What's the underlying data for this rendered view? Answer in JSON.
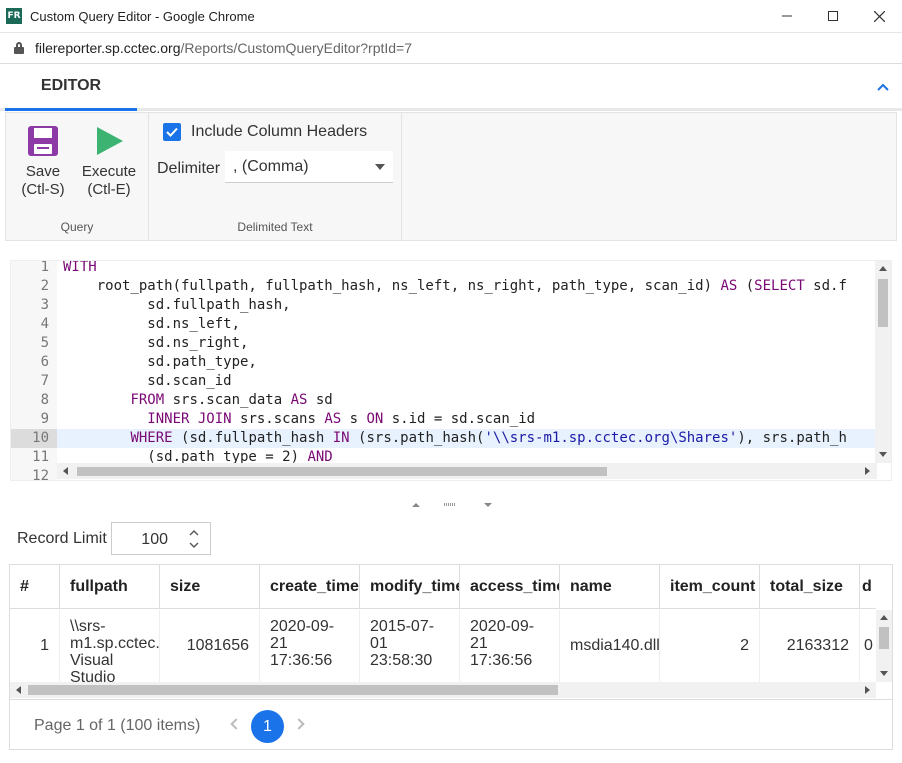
{
  "window": {
    "app_icon": "FR",
    "title": "Custom Query Editor - Google Chrome",
    "url_host": "filereporter.sp.cctec.org",
    "url_path": "/Reports/CustomQueryEditor?rptId=7"
  },
  "tabs": {
    "editor": "EDITOR"
  },
  "ribbon": {
    "save_l1": "Save",
    "save_l2": "(Ctl-S)",
    "execute_l1": "Execute",
    "execute_l2": "(Ctl-E)",
    "query_group": "Query",
    "include_headers": "Include Column Headers",
    "include_headers_checked": true,
    "delimiter_label": "Delimiter",
    "delimiter_value": ", (Comma)",
    "delimited_group": "Delimited Text"
  },
  "code": {
    "active_line": 10,
    "lines": [
      {
        "n": "1",
        "parts": [
          [
            "kw",
            "WITH"
          ]
        ]
      },
      {
        "n": "2",
        "parts": [
          [
            "t",
            "    root_path(fullpath, fullpath_hash, ns_left, ns_right, path_type, scan_id) "
          ],
          [
            "kw",
            "AS"
          ],
          [
            "t",
            " ("
          ],
          [
            "kw",
            "SELECT"
          ],
          [
            "t",
            " sd.f"
          ]
        ]
      },
      {
        "n": "3",
        "parts": [
          [
            "t",
            "          sd.fullpath_hash,"
          ]
        ]
      },
      {
        "n": "4",
        "parts": [
          [
            "t",
            "          sd.ns_left,"
          ]
        ]
      },
      {
        "n": "5",
        "parts": [
          [
            "t",
            "          sd.ns_right,"
          ]
        ]
      },
      {
        "n": "6",
        "parts": [
          [
            "t",
            "          sd.path_type,"
          ]
        ]
      },
      {
        "n": "7",
        "parts": [
          [
            "t",
            "          sd.scan_id"
          ]
        ]
      },
      {
        "n": "8",
        "parts": [
          [
            "t",
            "        "
          ],
          [
            "kw",
            "FROM"
          ],
          [
            "t",
            " srs.scan_data "
          ],
          [
            "kw",
            "AS"
          ],
          [
            "t",
            " sd"
          ]
        ]
      },
      {
        "n": "9",
        "parts": [
          [
            "t",
            "          "
          ],
          [
            "kw",
            "INNER JOIN"
          ],
          [
            "t",
            " srs.scans "
          ],
          [
            "kw",
            "AS"
          ],
          [
            "t",
            " s "
          ],
          [
            "kw",
            "ON"
          ],
          [
            "t",
            " s.id = sd.scan_id"
          ]
        ]
      },
      {
        "n": "10",
        "parts": [
          [
            "t",
            "        "
          ],
          [
            "kw",
            "WHERE"
          ],
          [
            "t",
            " (sd.fullpath_hash "
          ],
          [
            "kw",
            "IN"
          ],
          [
            "t",
            " (srs.path_hash("
          ],
          [
            "str",
            "'\\\\srs-m1.sp.cctec.org\\Shares'"
          ],
          [
            "t",
            "), srs.path_h"
          ]
        ]
      },
      {
        "n": "11",
        "parts": [
          [
            "t",
            "          (sd.path_type = 2) "
          ],
          [
            "kw",
            "AND"
          ]
        ]
      },
      {
        "n": "12",
        "parts": [
          [
            "t",
            ""
          ]
        ]
      }
    ]
  },
  "record_limit": {
    "label": "Record Limit",
    "value": "100"
  },
  "grid": {
    "columns": [
      "#",
      "fullpath",
      "size",
      "create_time",
      "modify_time",
      "access_time",
      "name",
      "item_count",
      "total_size",
      "d"
    ],
    "row": {
      "num": "1",
      "fullpath": [
        "\\\\srs-",
        "m1.sp.cctec.",
        "Visual",
        "Studio"
      ],
      "size": "1081656",
      "create_time": [
        "2020-09-",
        "21",
        "17:36:56"
      ],
      "modify_time": [
        "2015-07-",
        "01",
        "23:58:30"
      ],
      "access_time": [
        "2020-09-",
        "21",
        "17:36:56"
      ],
      "name": "msdia140.dll",
      "item_count": "2",
      "total_size": "2163312",
      "extra": "0"
    },
    "pager_info": "Page 1 of 1 (100 items)",
    "current_page": "1"
  }
}
